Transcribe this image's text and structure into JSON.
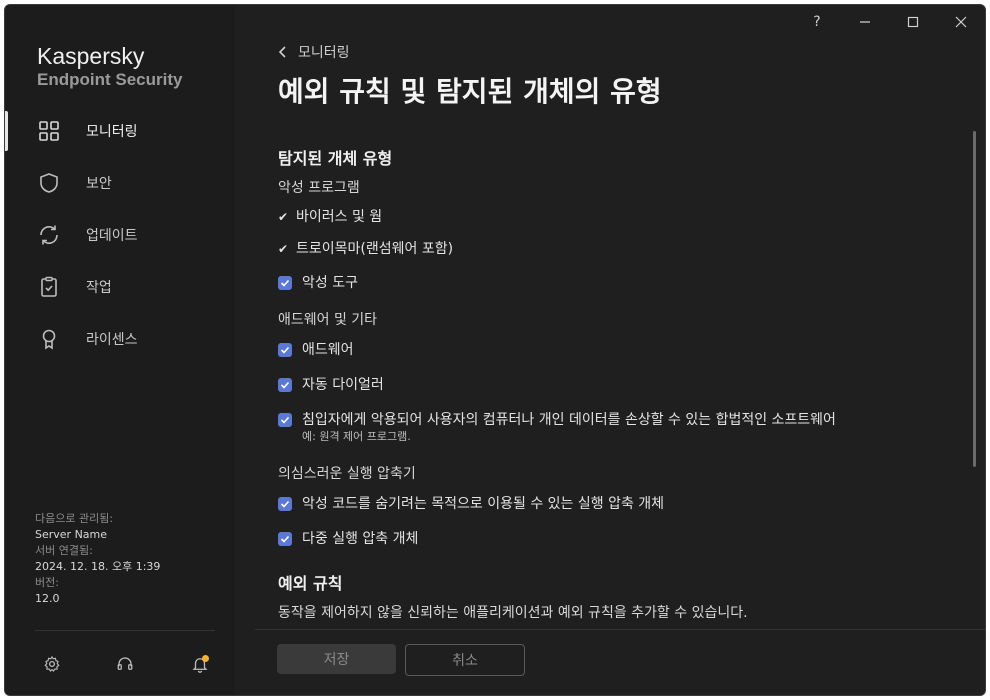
{
  "window": {
    "help_icon": "?"
  },
  "brand": {
    "name": "Kaspersky",
    "product": "Endpoint Security"
  },
  "nav": {
    "items": [
      {
        "label": "모니터링",
        "icon": "grid-icon",
        "active": true
      },
      {
        "label": "보안",
        "icon": "shield-icon",
        "active": false
      },
      {
        "label": "업데이트",
        "icon": "refresh-icon",
        "active": false
      },
      {
        "label": "작업",
        "icon": "clipboard-icon",
        "active": false
      },
      {
        "label": "라이센스",
        "icon": "license-icon",
        "active": false
      }
    ]
  },
  "info": {
    "managed_by_label": "다음으로 관리됨:",
    "managed_by_value": "Server Name",
    "connected_label": "서버 연결됨:",
    "connected_value": "2024. 12. 18. 오후 1:39",
    "version_label": "버전:",
    "version_value": "12.0"
  },
  "header": {
    "back_label": "모니터링",
    "title": "예외 규칙 및 탐지된 개체의 유형"
  },
  "detected": {
    "title": "탐지된 개체 유형",
    "malware_heading": "악성 프로그램",
    "fixed_items": [
      "바이러스 및 웜",
      "트로이목마(랜섬웨어 포함)"
    ],
    "malware_tools": "악성 도구",
    "adware_heading": "애드웨어 및 기타",
    "adware": "애드웨어",
    "autodialer": "자동 다이얼러",
    "legit_software": "침입자에게 악용되어 사용자의 컴퓨터나 개인 데이터를 손상할 수 있는 합법적인 소프트웨어",
    "legit_software_hint": "예: 원격 제어 프로그램.",
    "packers_heading": "의심스러운 실행 압축기",
    "packers": "악성 코드를 숨기려는 목적으로 이용될 수 있는 실행 압축 개체",
    "multipacked": "다중 실행 압축 개체"
  },
  "exclusions": {
    "title": "예외 규칙",
    "description": "동작을 제어하지 않을 신뢰하는 애플리케이션과 예외 규칙을 추가할 수 있습니다."
  },
  "footer": {
    "save_label": "저장",
    "cancel_label": "취소"
  },
  "colors": {
    "background": "#1f1f1f",
    "checkbox": "#5a78d4",
    "notification_dot": "#f2b233"
  }
}
